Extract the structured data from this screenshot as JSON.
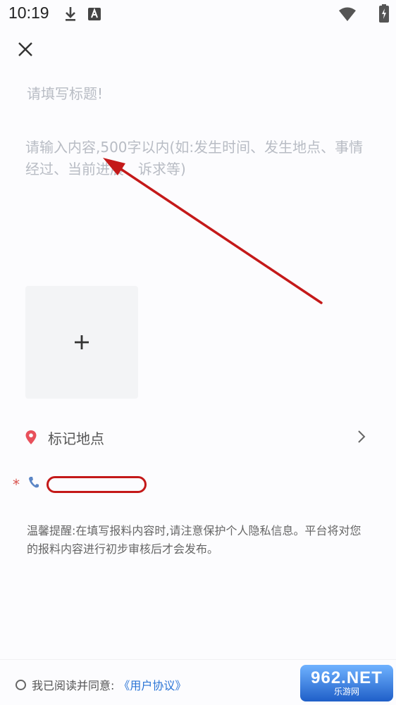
{
  "status_bar": {
    "time": "10:19",
    "icons": [
      "download-icon",
      "text-a-icon",
      "wifi-icon",
      "battery-charging-icon"
    ]
  },
  "header": {
    "close_icon": "close-icon"
  },
  "form": {
    "title_placeholder": "请填写标题!",
    "content_placeholder": "请输入内容,500字以内(如:发生时间、发生地点、事情经过、当前进展、诉求等)",
    "upload_icon": "plus-icon",
    "location_label": "标记地点",
    "location_icon": "location-pin-icon",
    "required_mark": "*",
    "phone_icon": "phone-icon"
  },
  "tip": {
    "text": "温馨提醒:在填写报料内容时,请注意保护个人隐私信息。平台将对您的报料内容进行初步审核后才会发布。"
  },
  "footer": {
    "agree_text": "我已阅读并同意:",
    "agreement_link": "《用户协议》"
  },
  "watermark": {
    "main": "962.NET",
    "sub": "乐游网"
  },
  "colors": {
    "background": "#fcfcfe",
    "placeholder": "#b8bcc4",
    "link": "#2a74d6",
    "pin": "#e8505b",
    "phone": "#5b86c6",
    "annotation_red": "#c41919"
  }
}
